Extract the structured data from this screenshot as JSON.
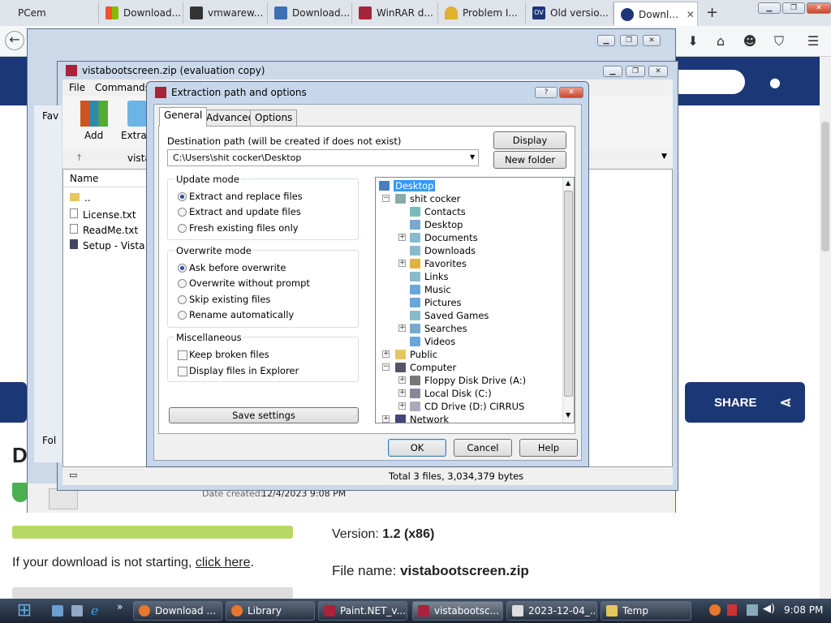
{
  "browser": {
    "tabs": [
      {
        "label": "PCem",
        "color": "#dfe3ea"
      },
      {
        "label": "Download...",
        "color": "#f35325"
      },
      {
        "label": "vmwarew...",
        "color": "#333"
      },
      {
        "label": "Download...",
        "color": "#3f6fb5"
      },
      {
        "label": "WinRAR d...",
        "color": "#a8243a"
      },
      {
        "label": "Problem I...",
        "color": "#e0b030"
      },
      {
        "label": "Old versio...",
        "color": "#1c3776"
      },
      {
        "label": "Downl...",
        "color": "#1c3776"
      }
    ],
    "new_tab": "+"
  },
  "webpage": {
    "share_label": "SHARE",
    "left_bar_text": "Fol",
    "heading_initial": "D",
    "download_hint": "If your download is not starting, ",
    "click_here": "click here",
    "hint_end": ".",
    "version_label": "Version: ",
    "version_value": "1.2 (x86)",
    "filename_label": "File name: ",
    "filename_value": "vistabootscreen.zip",
    "date_created_label": "Date created:",
    "date_created_value": "12/4/2023 9:08 PM"
  },
  "winrar": {
    "title": "vistabootscreen.zip (evaluation copy)",
    "menu": [
      "File",
      "Commands"
    ],
    "toolbar": [
      "Add",
      "Extract"
    ],
    "path_text": "vista",
    "fav_text": "Fav",
    "column_name": "Name",
    "files": [
      "..",
      "License.txt",
      "ReadMe.txt",
      "Setup - Vista Bo"
    ],
    "status": "Total 3 files, 3,034,379 bytes"
  },
  "dialog": {
    "title": "Extraction path and options",
    "help_glyph": "?",
    "tabs": [
      "General",
      "Advanced",
      "Options"
    ],
    "dest_label": "Destination path (will be created if does not exist)",
    "dest_value": "C:\\Users\\shit cocker\\Desktop",
    "display_btn": "Display",
    "new_folder_btn": "New folder",
    "update_mode": {
      "title": "Update mode",
      "options": [
        "Extract and replace files",
        "Extract and update files",
        "Fresh existing files only"
      ],
      "selected": 0
    },
    "overwrite_mode": {
      "title": "Overwrite mode",
      "options": [
        "Ask before overwrite",
        "Overwrite without prompt",
        "Skip existing files",
        "Rename automatically"
      ],
      "selected": 0
    },
    "misc": {
      "title": "Miscellaneous",
      "options": [
        "Keep broken files",
        "Display files in Explorer"
      ]
    },
    "save_settings": "Save settings",
    "tree": [
      "Desktop",
      "shit cocker",
      "Contacts",
      "Desktop",
      "Documents",
      "Downloads",
      "Favorites",
      "Links",
      "Music",
      "Pictures",
      "Saved Games",
      "Searches",
      "Videos",
      "Public",
      "Computer",
      "Floppy Disk Drive (A:)",
      "Local Disk (C:)",
      "CD Drive (D:) CIRRUS",
      "Network"
    ],
    "ok": "OK",
    "cancel": "Cancel",
    "help": "Help"
  },
  "taskbar": {
    "items": [
      "Download ...",
      "Library",
      "Paint.NET_v...",
      "vistabootsc...",
      "2023-12-04_...",
      "Temp"
    ],
    "time": "9:08 PM"
  }
}
